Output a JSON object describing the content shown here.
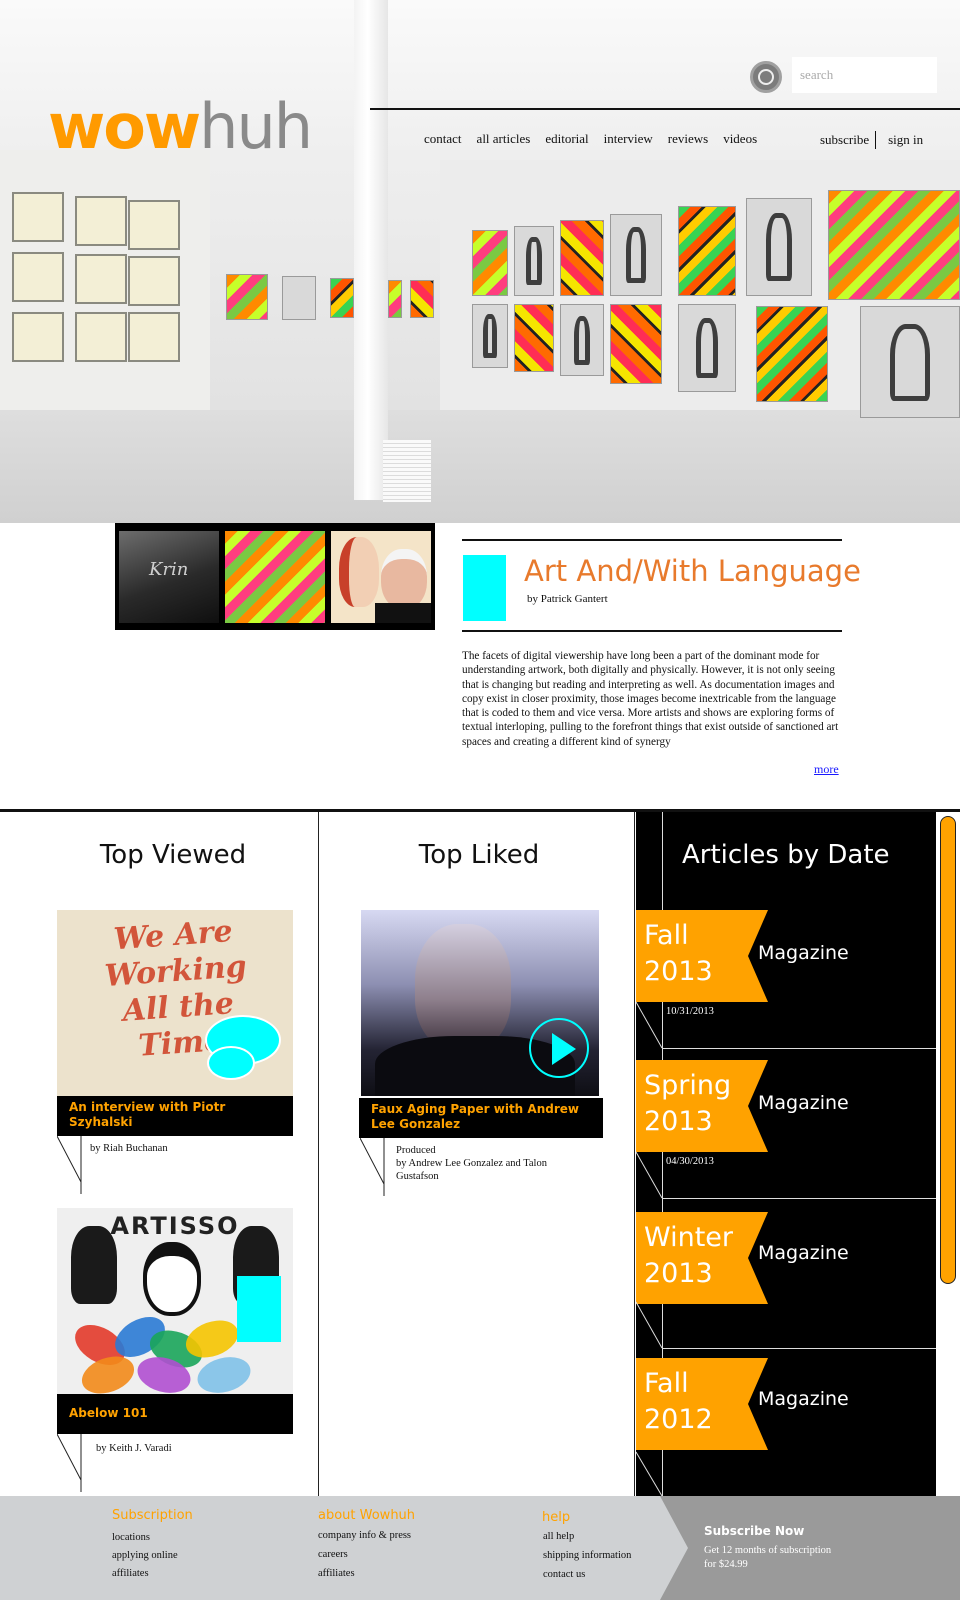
{
  "brand": {
    "logo_part1": "wow",
    "logo_part2": "huh",
    "accent": "#ff9a00",
    "highlight": "#00ffff"
  },
  "search": {
    "placeholder": "search"
  },
  "nav": {
    "items": [
      "contact",
      "all articles",
      "editorial",
      "interview",
      "reviews",
      "videos"
    ]
  },
  "account": {
    "subscribe": "subscribe",
    "signin": "sign in"
  },
  "feature": {
    "title": "Art And/With Language",
    "byline": "by Patrick Gantert",
    "body": "The facets of digital viewership have long been a part of the dominant mode for understanding artwork, both digitally and physically. However, it is not only seeing that is changing but reading and interpreting as well. As documentation images and copy exist in closer proximity, those images become inextricable from the language that is coded to them and vice versa. More artists and shows are exploring forms of textual interloping, pulling to the forefront things that exist outside of sanctioned art spaces and creating a different kind of synergy",
    "more": "more",
    "thumb_chalk": "Krin"
  },
  "top_viewed": {
    "heading": "Top Viewed",
    "items": [
      {
        "caption": "An interview with Piotr Szyhalski",
        "byline": "by Riah Buchanan",
        "art_text": "We Are Working All the Time"
      },
      {
        "caption": "Abelow 101",
        "byline": "by Keith J. Varadi",
        "art_text": "ARTISSO"
      }
    ]
  },
  "top_liked": {
    "heading": "Top Liked",
    "items": [
      {
        "caption": "Faux Aging Paper with Andrew Lee Gonzalez",
        "byline": "Produced\nby Andrew Lee Gonzalez and Talon Gustafson"
      }
    ]
  },
  "articles_by_date": {
    "heading": "Articles by Date",
    "issues": [
      {
        "season": "Fall",
        "year": "2013",
        "label": "Magazine",
        "date": "10/31/2013"
      },
      {
        "season": "Spring",
        "year": "2013",
        "label": "Magazine",
        "date": "04/30/2013"
      },
      {
        "season": "Winter",
        "year": "2013",
        "label": "Magazine",
        "date": ""
      },
      {
        "season": "Fall",
        "year": "2012",
        "label": "Magazine",
        "date": ""
      }
    ]
  },
  "footer": {
    "subscription": {
      "heading": "Subscription",
      "links": [
        "locations",
        "applying online",
        "affiliates"
      ]
    },
    "about": {
      "heading": "about Wowhuh",
      "links": [
        "company info & press",
        "careers",
        "affiliates"
      ]
    },
    "help": {
      "heading": "help",
      "links": [
        "all help",
        "shipping information",
        "contact us"
      ]
    },
    "subscribe_now": {
      "heading": "Subscribe Now",
      "text": "Get 12 months of subscription for $24.99"
    }
  }
}
